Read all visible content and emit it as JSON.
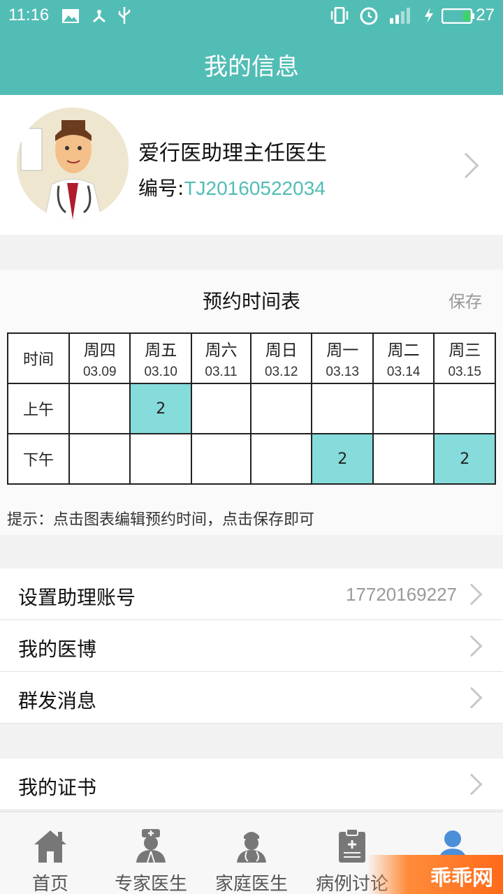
{
  "statusbar": {
    "time": "11:16",
    "battery": "27"
  },
  "header": {
    "title": "我的信息"
  },
  "profile": {
    "name": "爱行医助理主任医生",
    "id_label": "编号:",
    "id_value": "TJ20160522034"
  },
  "schedule": {
    "title": "预约时间表",
    "save_label": "保存",
    "time_header": "时间",
    "days": [
      {
        "day": "周四",
        "date": "03.09"
      },
      {
        "day": "周五",
        "date": "03.10"
      },
      {
        "day": "周六",
        "date": "03.11"
      },
      {
        "day": "周日",
        "date": "03.12"
      },
      {
        "day": "周一",
        "date": "03.13"
      },
      {
        "day": "周二",
        "date": "03.14"
      },
      {
        "day": "周三",
        "date": "03.15"
      }
    ],
    "rows": [
      {
        "label": "上午",
        "cells": [
          "",
          "2",
          "",
          "",
          "",
          "",
          ""
        ]
      },
      {
        "label": "下午",
        "cells": [
          "",
          "",
          "",
          "",
          "2",
          "",
          "2"
        ]
      }
    ],
    "hint": "提示：点击图表编辑预约时间，点击保存即可"
  },
  "menu1": [
    {
      "label": "设置助理账号",
      "value": "17720169227"
    },
    {
      "label": "我的医博",
      "value": ""
    },
    {
      "label": "群发消息",
      "value": ""
    }
  ],
  "menu2": [
    {
      "label": "我的证书",
      "value": ""
    }
  ],
  "tabs": [
    {
      "label": "首页",
      "icon": "home-icon"
    },
    {
      "label": "专家医生",
      "icon": "nurse-icon"
    },
    {
      "label": "家庭医生",
      "icon": "doctor-icon"
    },
    {
      "label": "病例讨论",
      "icon": "clipboard-icon"
    },
    {
      "label": "",
      "icon": "person-icon"
    }
  ],
  "watermark": "乖乖网",
  "colors": {
    "primary": "#52bdb5",
    "highlight": "#86dbdb",
    "tab_active": "#4a8fd8"
  }
}
